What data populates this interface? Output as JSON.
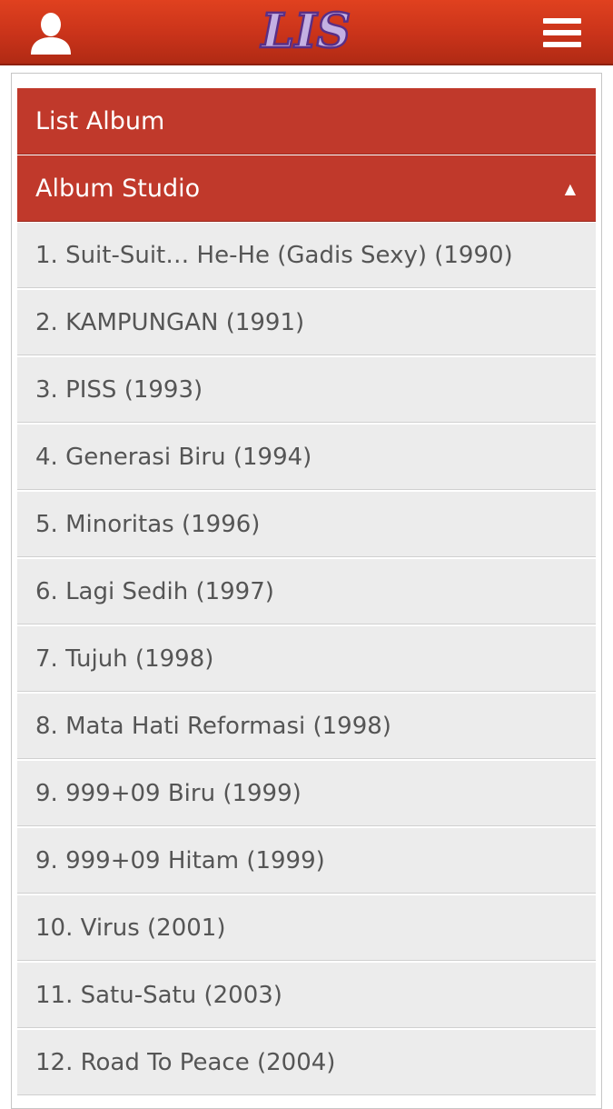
{
  "header": {
    "logo_text": "LIS",
    "icons": {
      "user": "user-icon",
      "menu": "hamburger-menu-icon",
      "collapse": "triangle-up-icon"
    },
    "colors": {
      "brand_red": "#c0392b",
      "topbar_red": "#d63a1c",
      "logo_purple": "#b8a2d8"
    }
  },
  "section": {
    "title": "List Album",
    "category": "Album Studio",
    "category_arrow": "▲"
  },
  "albums": [
    {
      "label": "1. Suit-Suit… He-He (Gadis Sexy) (1990)"
    },
    {
      "label": "2. KAMPUNGAN (1991)"
    },
    {
      "label": "3. PISS (1993)"
    },
    {
      "label": "4. Generasi Biru (1994)"
    },
    {
      "label": "5. Minoritas (1996)"
    },
    {
      "label": "6. Lagi Sedih (1997)"
    },
    {
      "label": "7. Tujuh (1998)"
    },
    {
      "label": "8. Mata Hati Reformasi (1998)"
    },
    {
      "label": "9. 999+09 Biru (1999)"
    },
    {
      "label": "9. 999+09 Hitam (1999)"
    },
    {
      "label": "10. Virus (2001)"
    },
    {
      "label": "11. Satu-Satu (2003)"
    },
    {
      "label": "12. Road To Peace (2004)"
    }
  ]
}
